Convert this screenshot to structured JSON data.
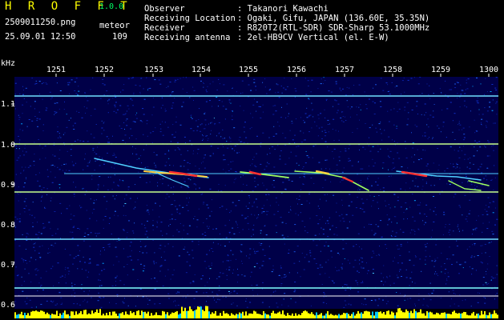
{
  "app": {
    "name": "H R O F F T",
    "version": "1.0.0"
  },
  "file": {
    "name": "2509011250.png",
    "timestamp": "25.09.01 12:50"
  },
  "counter": {
    "type": "meteor",
    "count": "109"
  },
  "info": [
    {
      "label": "Observer",
      "value": ": Takanori Kawachi"
    },
    {
      "label": "Receiving Location",
      "value": ": Ogaki, Gifu, JAPAN (136.60E, 35.35N)"
    },
    {
      "label": "Receiver",
      "value": ": R820T2(RTL-SDR) SDR-Sharp 53.1000MHz"
    },
    {
      "label": "Receiving antenna",
      "value": ": 2el-HB9CV Vertical (el. E-W)"
    }
  ],
  "axes": {
    "y_unit": "kHz",
    "x_ticks": [
      "1251",
      "1252",
      "1253",
      "1254",
      "1255",
      "1256",
      "1257",
      "1258",
      "1259",
      "1300"
    ],
    "y_ticks": [
      "1.1",
      "1.0",
      "0.9",
      "0.8",
      "0.7",
      "0.6"
    ]
  },
  "colors": {
    "background": "#000030",
    "text_yellow": "#ffff00",
    "text_white": "#ffffff",
    "carrier": "#c8ff8c",
    "echo_peak": "#ff3030",
    "activity_bar": "#ffff00"
  }
}
